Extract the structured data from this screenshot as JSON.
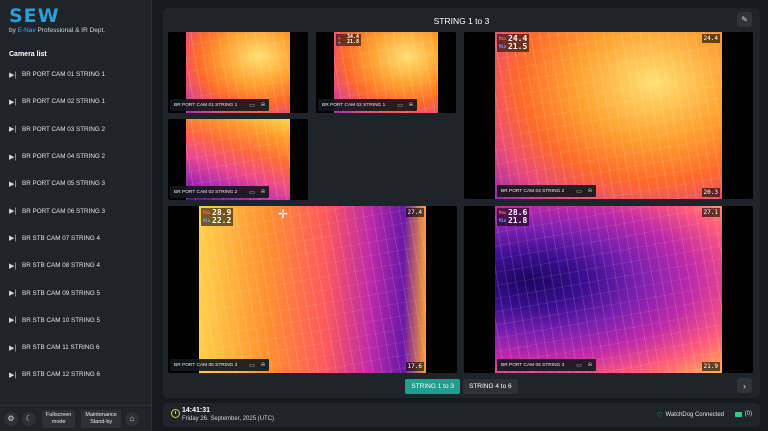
{
  "app": {
    "logo": "SEW",
    "logo_by": "by ",
    "logo_enav": "E-Nav",
    "logo_rest": " Professional & IR Dept."
  },
  "sidebar": {
    "title": "Camera list",
    "cameras": [
      "BR PORT CAM 01 STRING 1",
      "BR PORT CAM 02 STRING 1",
      "BR PORT CAM 03 STRING 2",
      "BR PORT CAM 04 STRING 2",
      "BR PORT CAM 05 STRING 3",
      "BR PORT CAM 06 STRING 3",
      "BR STB CAM 07 STRING 4",
      "BR STB CAM 08 STRING 4",
      "BR STB CAM 09 STRING 5",
      "BR STB CAM 10 STRING 5",
      "BR STB CAM 11 STRING 6",
      "BR STB CAM 12 STRING 6"
    ],
    "fullscreen_l1": "Fullscreen",
    "fullscreen_l2": "mode",
    "maintenance_l1": "Maintenance",
    "maintenance_l2": "Stand-by"
  },
  "main": {
    "title": "STRING 1 to 3",
    "tiles": [
      {
        "name": "BR PORT CAM 01 STRING 1"
      },
      {
        "name": "BR PORT CAM 02 STRING 1",
        "max": "34.4",
        "min": "21.8"
      },
      {
        "name": "BR PORT CAM 03 STRING 2"
      },
      {
        "name": "BR PORT CAM 04 STRING 2",
        "max": "24.4",
        "min": "21.5",
        "corner_max": "24.4",
        "corner_min": "20.3"
      },
      {
        "name": "BR PORT CAM 05 STRING 3",
        "max": "28.9",
        "min": "22.2",
        "corner_max": "27.4",
        "corner_min": "17.6"
      },
      {
        "name": "BR PORT CAM 06 STRING 3",
        "max": "28.6",
        "min": "21.8",
        "corner_max": "27.1",
        "corner_min": "21.9"
      }
    ],
    "unit": "°C",
    "tabs": [
      "STRING 1 to 3",
      "STRING 4 to 6"
    ]
  },
  "status": {
    "time": "14:41:31",
    "date": "Friday 26. September, 2025 (UTC)",
    "watchdog": "WatchDog Connected",
    "folder_count": "(0)"
  }
}
